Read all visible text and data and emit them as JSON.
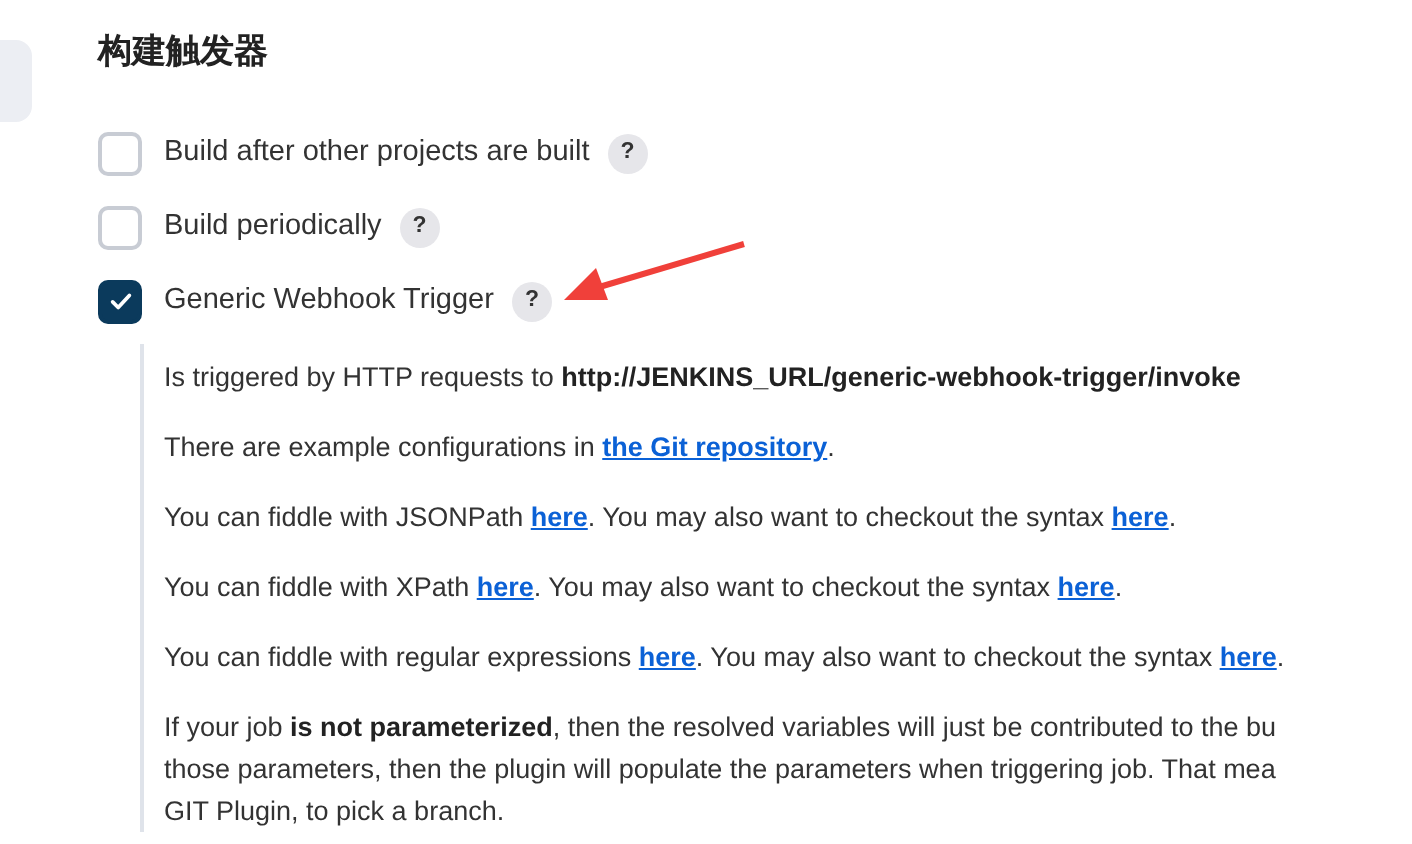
{
  "section_title": "构建触发器",
  "triggers": [
    {
      "label": "Build after other projects are built",
      "checked": false,
      "help": "?"
    },
    {
      "label": "Build periodically",
      "checked": false,
      "help": "?"
    },
    {
      "label": "Generic Webhook Trigger",
      "checked": true,
      "help": "?"
    }
  ],
  "annotation": {
    "kind": "arrow"
  },
  "description": [
    {
      "lines": [
        [
          {
            "kind": "text",
            "text": "Is triggered by HTTP requests to "
          },
          {
            "kind": "bold",
            "text": "http://JENKINS_URL/generic-webhook-trigger/invoke"
          }
        ]
      ]
    },
    {
      "lines": [
        [
          {
            "kind": "text",
            "text": "There are example configurations in "
          },
          {
            "kind": "link",
            "text": "the Git repository"
          },
          {
            "kind": "text",
            "text": "."
          }
        ]
      ]
    },
    {
      "lines": [
        [
          {
            "kind": "text",
            "text": "You can fiddle with JSONPath "
          },
          {
            "kind": "link",
            "text": "here"
          },
          {
            "kind": "text",
            "text": ". You may also want to checkout the syntax "
          },
          {
            "kind": "link",
            "text": "here"
          },
          {
            "kind": "text",
            "text": "."
          }
        ]
      ]
    },
    {
      "lines": [
        [
          {
            "kind": "text",
            "text": "You can fiddle with XPath "
          },
          {
            "kind": "link",
            "text": "here"
          },
          {
            "kind": "text",
            "text": ". You may also want to checkout the syntax "
          },
          {
            "kind": "link",
            "text": "here"
          },
          {
            "kind": "text",
            "text": "."
          }
        ]
      ]
    },
    {
      "lines": [
        [
          {
            "kind": "text",
            "text": "You can fiddle with regular expressions "
          },
          {
            "kind": "link",
            "text": "here"
          },
          {
            "kind": "text",
            "text": ". You may also want to checkout the syntax "
          },
          {
            "kind": "link",
            "text": "here"
          },
          {
            "kind": "text",
            "text": "."
          }
        ]
      ]
    },
    {
      "lines": [
        [
          {
            "kind": "text",
            "text": "If your job "
          },
          {
            "kind": "bold",
            "text": "is not parameterized"
          },
          {
            "kind": "text",
            "text": ", then the resolved variables will just be contributed to the bu"
          }
        ],
        [
          {
            "kind": "text",
            "text": "those parameters, then the plugin will populate the parameters when triggering job. That mea"
          }
        ],
        [
          {
            "kind": "text",
            "text": "GIT Plugin, to pick a branch."
          }
        ]
      ]
    }
  ]
}
